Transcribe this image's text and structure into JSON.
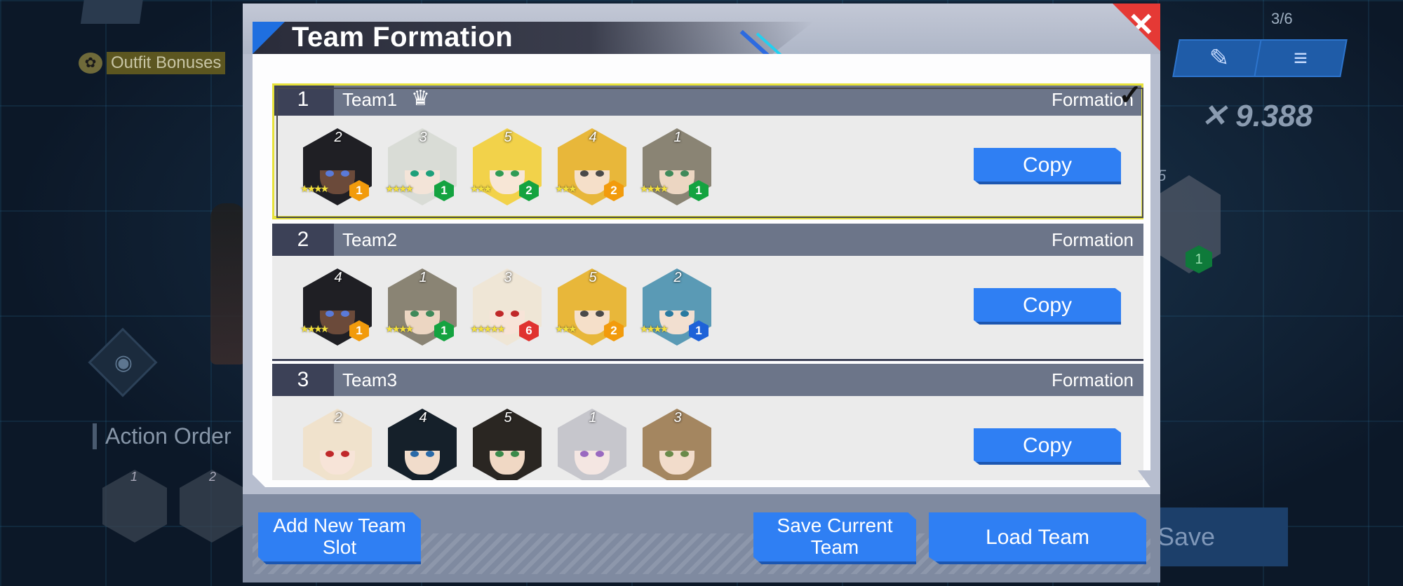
{
  "background": {
    "outfit_bonuses": "Outfit Bonuses",
    "action_order": "Action Order",
    "action_order_slots": [
      "1",
      "2"
    ],
    "team_counter": "3/6",
    "power": "9.388",
    "save_label": "Save",
    "right_badge": "1",
    "right_tile_num": "5"
  },
  "modal": {
    "title": "Team Formation",
    "close_symbol": "✕",
    "teams": [
      {
        "number": "1",
        "name": "Team1",
        "formation_label": "Formation",
        "copy_label": "Copy",
        "selected": true,
        "heroes": [
          {
            "pos": "2",
            "stars": "★★★★",
            "level": "1",
            "badge_color": "#f29b0c",
            "hair": "#1f1f24",
            "skin": "#6b4a3a",
            "eyes": "#5a7ad8"
          },
          {
            "pos": "3",
            "stars": "★★★★",
            "level": "1",
            "badge_color": "#14a340",
            "hair": "#d9dcd6",
            "skin": "#f3e4d8",
            "eyes": "#1fa07a"
          },
          {
            "pos": "5",
            "stars": "★★★",
            "level": "2",
            "badge_color": "#14a340",
            "hair": "#f2d24a",
            "skin": "#f7e6d6",
            "eyes": "#2f9b55"
          },
          {
            "pos": "4",
            "stars": "★★★",
            "level": "2",
            "badge_color": "#f29b0c",
            "hair": "#e8b73a",
            "skin": "#f5dfc9",
            "eyes": "#4a4a4a"
          },
          {
            "pos": "1",
            "stars": "★★★★",
            "level": "1",
            "badge_color": "#14a340",
            "hair": "#8a8474",
            "skin": "#ecd6c2",
            "eyes": "#3f8a5a"
          }
        ]
      },
      {
        "number": "2",
        "name": "Team2",
        "formation_label": "Formation",
        "copy_label": "Copy",
        "selected": false,
        "heroes": [
          {
            "pos": "4",
            "stars": "★★★★",
            "level": "1",
            "badge_color": "#f29b0c",
            "hair": "#1f1f24",
            "skin": "#6b4a3a",
            "eyes": "#5a7ad8"
          },
          {
            "pos": "1",
            "stars": "★★★★",
            "level": "1",
            "badge_color": "#14a340",
            "hair": "#8a8474",
            "skin": "#ecd6c2",
            "eyes": "#3f8a5a"
          },
          {
            "pos": "3",
            "stars": "★★★★★",
            "level": "6",
            "badge_color": "#e0332f",
            "hair": "#efe6d6",
            "skin": "#f7e4d8",
            "eyes": "#c0282a"
          },
          {
            "pos": "5",
            "stars": "★★★",
            "level": "2",
            "badge_color": "#f29b0c",
            "hair": "#e8b73a",
            "skin": "#f5dfc9",
            "eyes": "#4a4a4a"
          },
          {
            "pos": "2",
            "stars": "★★★★",
            "level": "1",
            "badge_color": "#1e62d8",
            "hair": "#5a9ab5",
            "skin": "#f2dfd0",
            "eyes": "#2a7aa0"
          }
        ]
      },
      {
        "number": "3",
        "name": "Team3",
        "formation_label": "Formation",
        "copy_label": "Copy",
        "selected": false,
        "heroes": [
          {
            "pos": "2",
            "stars": "",
            "level": "",
            "badge_color": "#f29b0c",
            "hair": "#f0e2cc",
            "skin": "#f7e4d8",
            "eyes": "#c0282a"
          },
          {
            "pos": "4",
            "stars": "",
            "level": "",
            "badge_color": "#14a340",
            "hair": "#15202a",
            "skin": "#f1dccb",
            "eyes": "#2a6aa8"
          },
          {
            "pos": "5",
            "stars": "",
            "level": "",
            "badge_color": "#14a340",
            "hair": "#2a2622",
            "skin": "#f0d8c4",
            "eyes": "#3a8a4a"
          },
          {
            "pos": "1",
            "stars": "",
            "level": "",
            "badge_color": "#14a340",
            "hair": "#c6c6cc",
            "skin": "#f4e6e2",
            "eyes": "#9a6ac0"
          },
          {
            "pos": "3",
            "stars": "",
            "level": "",
            "badge_color": "#14a340",
            "hair": "#a48660",
            "skin": "#f2dccb",
            "eyes": "#6a8a4a"
          }
        ]
      }
    ],
    "footer": {
      "add_slot": "Add New Team Slot",
      "save_current": "Save Current Team",
      "load_team": "Load Team"
    }
  }
}
